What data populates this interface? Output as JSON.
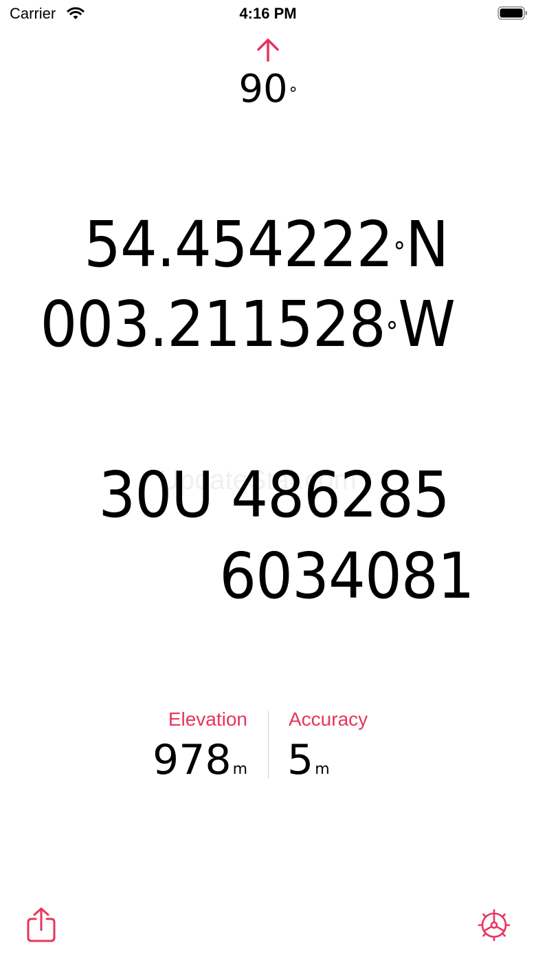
{
  "status_bar": {
    "carrier": "Carrier",
    "time": "4:16 PM",
    "wifi_icon": "wifi-icon",
    "battery_icon": "battery-icon"
  },
  "heading": {
    "icon": "up-arrow-icon",
    "value": "90",
    "degree_symbol": "°"
  },
  "coordinates": {
    "latitude": {
      "number": "54.454222",
      "degree": "°",
      "hemisphere": "N"
    },
    "longitude": {
      "number": "003.211528",
      "degree": "°",
      "hemisphere": "W"
    }
  },
  "utm": {
    "zone_easting": "30U 486285",
    "northing": "6034081"
  },
  "watermark": "UpdateStar.com",
  "stats": {
    "elevation": {
      "label": "Elevation",
      "value": "978",
      "unit": "m"
    },
    "accuracy": {
      "label": "Accuracy",
      "value": "5",
      "unit": "m"
    }
  },
  "toolbar": {
    "share_icon": "share-icon",
    "settings_icon": "settings-icon"
  },
  "colors": {
    "accent": "#e8335c",
    "text": "#000000",
    "background": "#ffffff"
  }
}
